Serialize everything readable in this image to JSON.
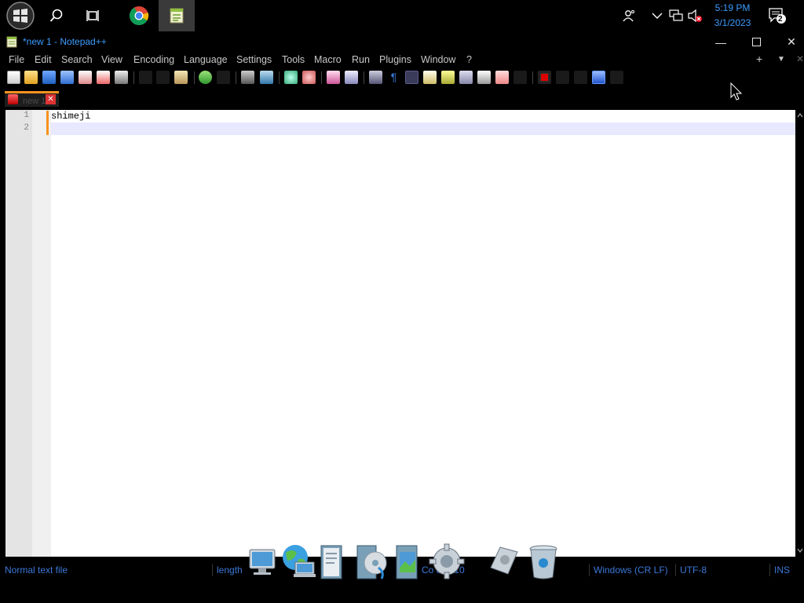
{
  "taskbar": {
    "start_icon": "windows-logo-icon",
    "search_icon": "search-icon",
    "taskview_icon": "task-view-icon",
    "apps": [
      {
        "name": "chrome-icon"
      },
      {
        "name": "notepadpp-icon"
      }
    ],
    "tray": {
      "people_icon": "people-icon",
      "chevron_icon": "chevron-up-icon",
      "network_icon": "network-icon",
      "volume_icon": "volume-muted-icon",
      "notification_icon": "notification-icon",
      "notification_count": "2"
    },
    "time": "5:19 PM",
    "date": "3/1/2023"
  },
  "window": {
    "title": "*new 1 - Notepad++",
    "minimize": "—",
    "maximize": "☐",
    "close": "✕"
  },
  "menu": {
    "items": [
      "File",
      "Edit",
      "Search",
      "View",
      "Encoding",
      "Language",
      "Settings",
      "Tools",
      "Macro",
      "Run",
      "Plugins",
      "Window",
      "?"
    ],
    "add_tab": "+",
    "dropdown": "▼",
    "close": "✕"
  },
  "tab": {
    "label": "new 1"
  },
  "editor": {
    "lines": [
      {
        "number": "1",
        "text": "shimeji"
      },
      {
        "number": "2",
        "text": ""
      }
    ]
  },
  "status": {
    "file_type": "Normal text file",
    "length": "length",
    "position": "Co       os : 10",
    "eol": "Windows (CR LF)",
    "encoding": "UTF-8",
    "mode": "INS"
  },
  "dock": {
    "items": [
      "computer-icon",
      "network-globe-icon",
      "documents-icon",
      "media-player-icon",
      "pictures-icon",
      "settings-gear-icon",
      "drive-icon",
      "recycle-bin-icon"
    ]
  },
  "colors": {
    "accent_blue": "#3b9cff",
    "tab_orange": "#f7931e"
  }
}
